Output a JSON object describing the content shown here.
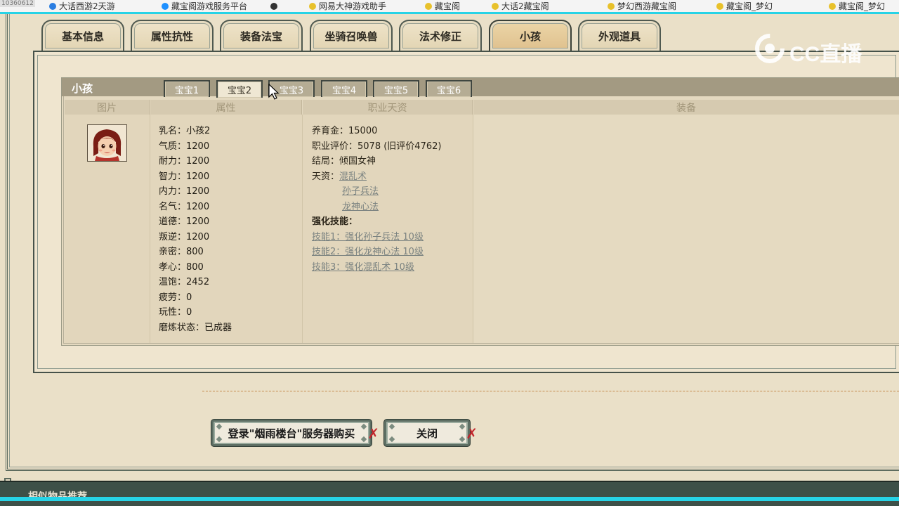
{
  "browser": {
    "corner_text": "10360612",
    "bookmarks": [
      "大话西游2天游",
      "藏宝阁游戏服务平台",
      "",
      "网易大神游戏助手",
      "藏宝阁",
      "大话2藏宝阁",
      "梦幻西游藏宝阁",
      "藏宝阁_梦幻",
      "藏宝阁_梦幻"
    ]
  },
  "main_tabs": [
    {
      "label": "基本信息",
      "active": false
    },
    {
      "label": "属性抗性",
      "active": false
    },
    {
      "label": "装备法宝",
      "active": false
    },
    {
      "label": "坐骑召唤兽",
      "active": false
    },
    {
      "label": "法术修正",
      "active": false
    },
    {
      "label": "小孩",
      "active": true
    },
    {
      "label": "外观道具",
      "active": false
    }
  ],
  "child_panel": {
    "title": "小孩",
    "sub_tabs": [
      {
        "label": "宝宝1",
        "active": false
      },
      {
        "label": "宝宝2",
        "active": true
      },
      {
        "label": "宝宝3",
        "active": false
      },
      {
        "label": "宝宝4",
        "active": false
      },
      {
        "label": "宝宝5",
        "active": false
      },
      {
        "label": "宝宝6",
        "active": false
      }
    ],
    "columns": [
      "图片",
      "属性",
      "职业天资",
      "装备"
    ],
    "attributes": [
      {
        "k": "乳名：",
        "v": "小孩2"
      },
      {
        "k": "气质：",
        "v": "1200"
      },
      {
        "k": "耐力：",
        "v": "1200"
      },
      {
        "k": "智力：",
        "v": "1200"
      },
      {
        "k": "内力：",
        "v": "1200"
      },
      {
        "k": "名气：",
        "v": "1200"
      },
      {
        "k": "道德：",
        "v": "1200"
      },
      {
        "k": "叛逆：",
        "v": "1200"
      },
      {
        "k": "亲密：",
        "v": "800"
      },
      {
        "k": "孝心：",
        "v": "800"
      },
      {
        "k": "温饱：",
        "v": "2452"
      },
      {
        "k": "疲劳：",
        "v": "0"
      },
      {
        "k": "玩性：",
        "v": "0"
      },
      {
        "k": "磨炼状态：",
        "v": "已成器"
      }
    ],
    "career": {
      "fund_label": "养育金：",
      "fund_value": "15000",
      "rating_label": "职业评价：",
      "rating_value": "5078 (旧评价4762)",
      "ending_label": "结局：",
      "ending_value": "倾国女神",
      "talent_label": "天资：",
      "talents": [
        "混乱术",
        "孙子兵法",
        "龙神心法"
      ],
      "skill_label": "强化技能：",
      "skills": [
        "技能1：强化孙子兵法 10级",
        "技能2：强化龙神心法 10级",
        "技能3：强化混乱术 10级"
      ]
    }
  },
  "buttons": {
    "buy": "登录\"烟雨楼台\"服务器购买",
    "close": "关闭"
  },
  "watermark": "CC直播",
  "bottom_bar": {
    "title": "相似物品推荐"
  }
}
